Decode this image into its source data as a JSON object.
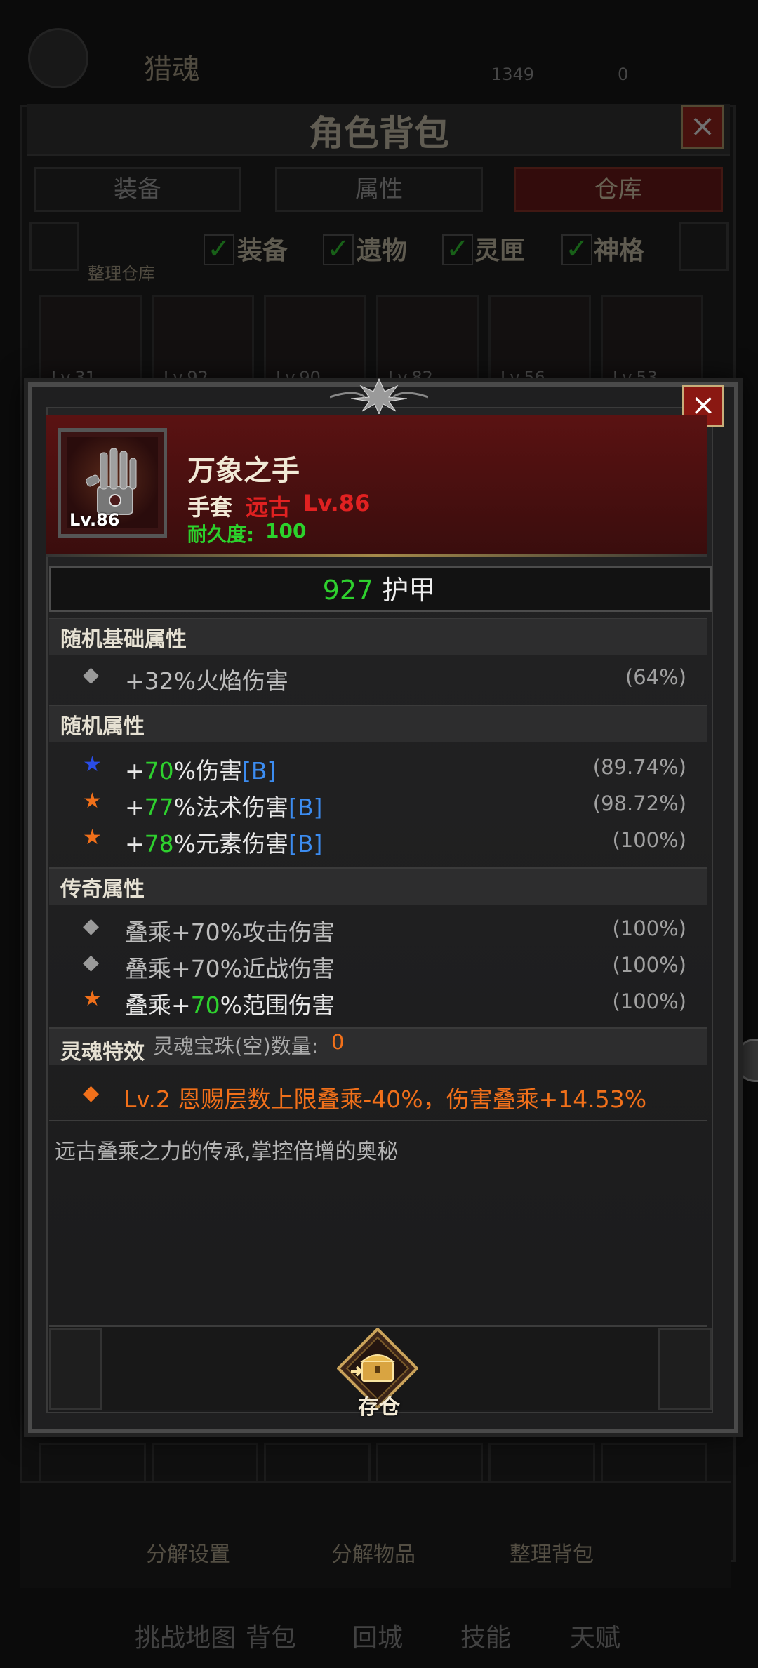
{
  "background": {
    "player_name": "猎魂",
    "resource_1": "1349",
    "resource_2": "0",
    "bag_title": "角色背包",
    "tabs": [
      {
        "label": "装备"
      },
      {
        "label": "属性"
      },
      {
        "label": "仓库"
      }
    ],
    "sort_label": "整理仓库",
    "filters": [
      {
        "label": "装备"
      },
      {
        "label": "遗物"
      },
      {
        "label": "灵匣"
      },
      {
        "label": "神格"
      }
    ],
    "slots": [
      {
        "level": "Lv.31"
      },
      {
        "level": "Lv.92"
      },
      {
        "level": "Lv.90"
      },
      {
        "level": "Lv.82"
      },
      {
        "level": "Lv.56"
      },
      {
        "level": "Lv.53"
      }
    ],
    "bottom_buttons": [
      {
        "label": "分解设置"
      },
      {
        "label": "分解物品"
      },
      {
        "label": "整理背包"
      }
    ],
    "nav": [
      {
        "label": "挑战地图"
      },
      {
        "label": "背包"
      },
      {
        "label": "回城"
      },
      {
        "label": "技能"
      },
      {
        "label": "天赋"
      }
    ]
  },
  "item": {
    "icon_level": "Lv.86",
    "name": "万象之手",
    "type": "手套",
    "rarity": "远古",
    "level": "Lv.86",
    "durability_label": "耐久度:",
    "durability_value": "100",
    "armor_value": "927",
    "armor_label": "护甲",
    "colors": {
      "rarity": "#e02121",
      "durability": "#2cd12c",
      "value_green": "#2ed02e",
      "tag_blue": "#3c8cf0",
      "orange": "#f1701a"
    }
  },
  "sections": {
    "base_title": "随机基础属性",
    "base_rows": [
      {
        "icon": "diamond-icon",
        "text": "+32%火焰伤害",
        "pct": "(64%)"
      }
    ],
    "random_title": "随机属性",
    "random_rows": [
      {
        "icon": "star-blue-icon",
        "prefix": "+",
        "value": "70",
        "suffix": "%伤害",
        "tag": "[B]",
        "pct": "(89.74%)"
      },
      {
        "icon": "star-orange-icon",
        "prefix": "+",
        "value": "77",
        "suffix": "%法术伤害",
        "tag": "[B]",
        "pct": "(98.72%)"
      },
      {
        "icon": "star-orange-icon",
        "prefix": "+",
        "value": "78",
        "suffix": "%元素伤害",
        "tag": "[B]",
        "pct": "(100%)"
      }
    ],
    "legend_title": "传奇属性",
    "legend_rows": [
      {
        "icon": "diamond-icon",
        "text": "叠乘+70%攻击伤害",
        "pct": "(100%)"
      },
      {
        "icon": "diamond-icon",
        "text": "叠乘+70%近战伤害",
        "pct": "(100%)"
      },
      {
        "icon": "star-orange-icon",
        "prefix": "叠乘+",
        "value": "70",
        "suffix": "%范围伤害",
        "pct": "(100%)"
      }
    ],
    "soul_title": "灵魂特效",
    "soul_count_label": "灵魂宝珠(空)数量:",
    "soul_count_value": "0",
    "soul_effect": "Lv.2 恩赐层数上限叠乘-40%，伤害叠乘+14.53%",
    "flavor": "远古叠乘之力的传承,掌控倍增的奥秘"
  },
  "actions": {
    "store_label": "存仓"
  }
}
